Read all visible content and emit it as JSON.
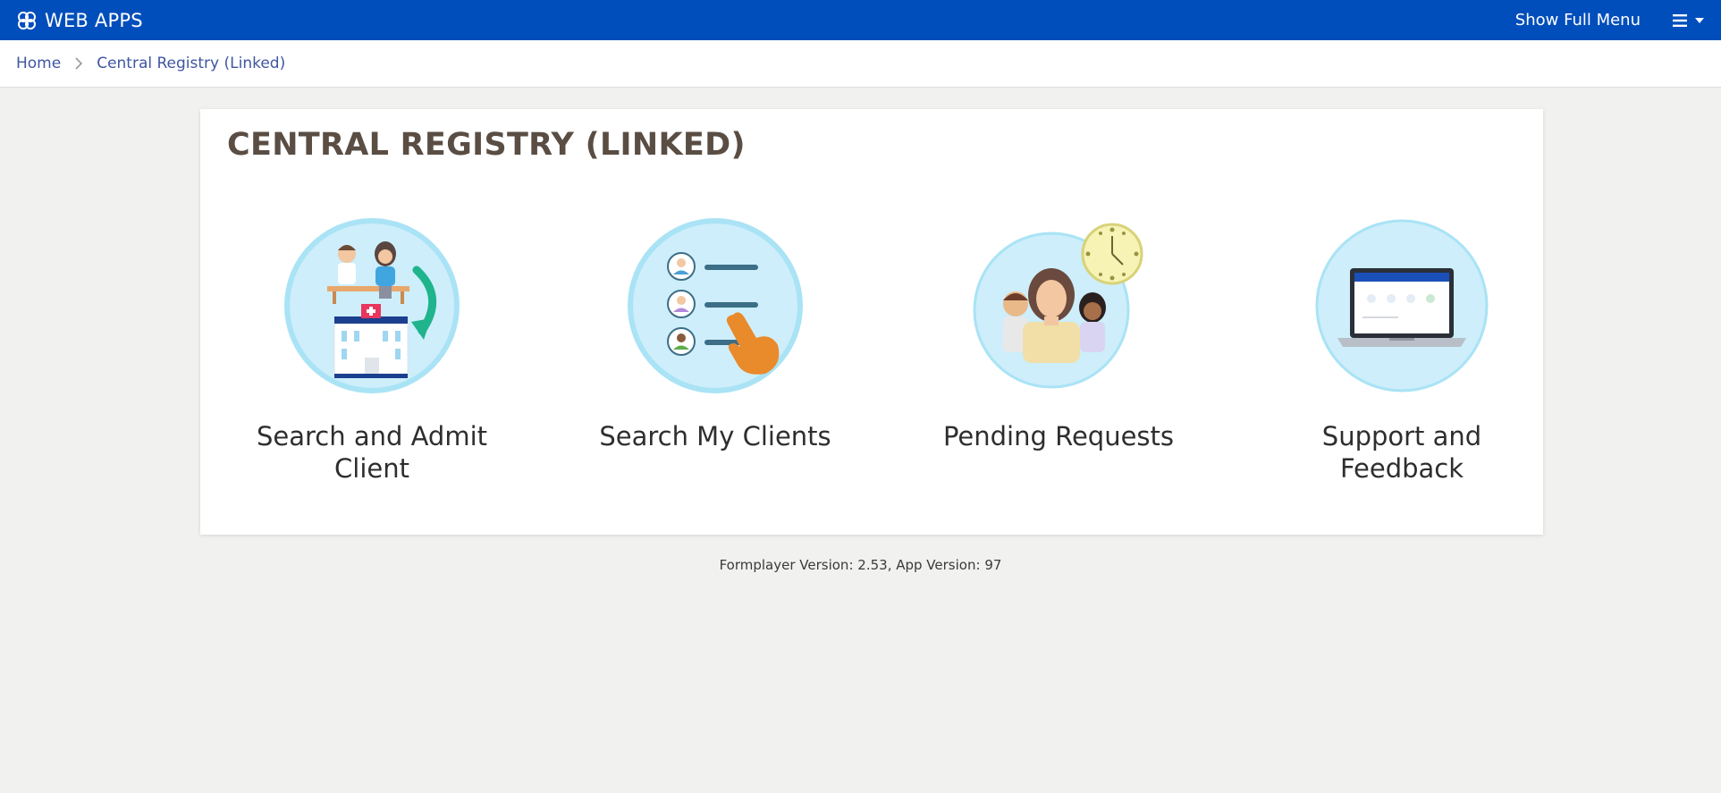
{
  "topbar": {
    "brand_label": "WEB APPS",
    "brand_icon": "commcare-logo-icon",
    "show_full_menu": "Show Full Menu",
    "menu_icon": "hamburger-menu-icon",
    "background_color": "#004ebc"
  },
  "breadcrumb": {
    "items": [
      {
        "label": "Home"
      },
      {
        "label": "Central Registry (Linked)"
      }
    ]
  },
  "main": {
    "title": "CENTRAL REGISTRY (LINKED)",
    "tiles": [
      {
        "label": "Search and Admit Client",
        "icon": "admit-client-hospital-icon"
      },
      {
        "label": "Search My Clients",
        "icon": "client-list-pointer-icon"
      },
      {
        "label": "Pending Requests",
        "icon": "pending-requests-clock-icon"
      },
      {
        "label": "Support and Feedback",
        "icon": "laptop-support-icon"
      }
    ]
  },
  "footer": {
    "formplayer_label": "Formplayer Version:",
    "formplayer_version": "2.53",
    "app_label": "App Version:",
    "app_version": "97"
  }
}
